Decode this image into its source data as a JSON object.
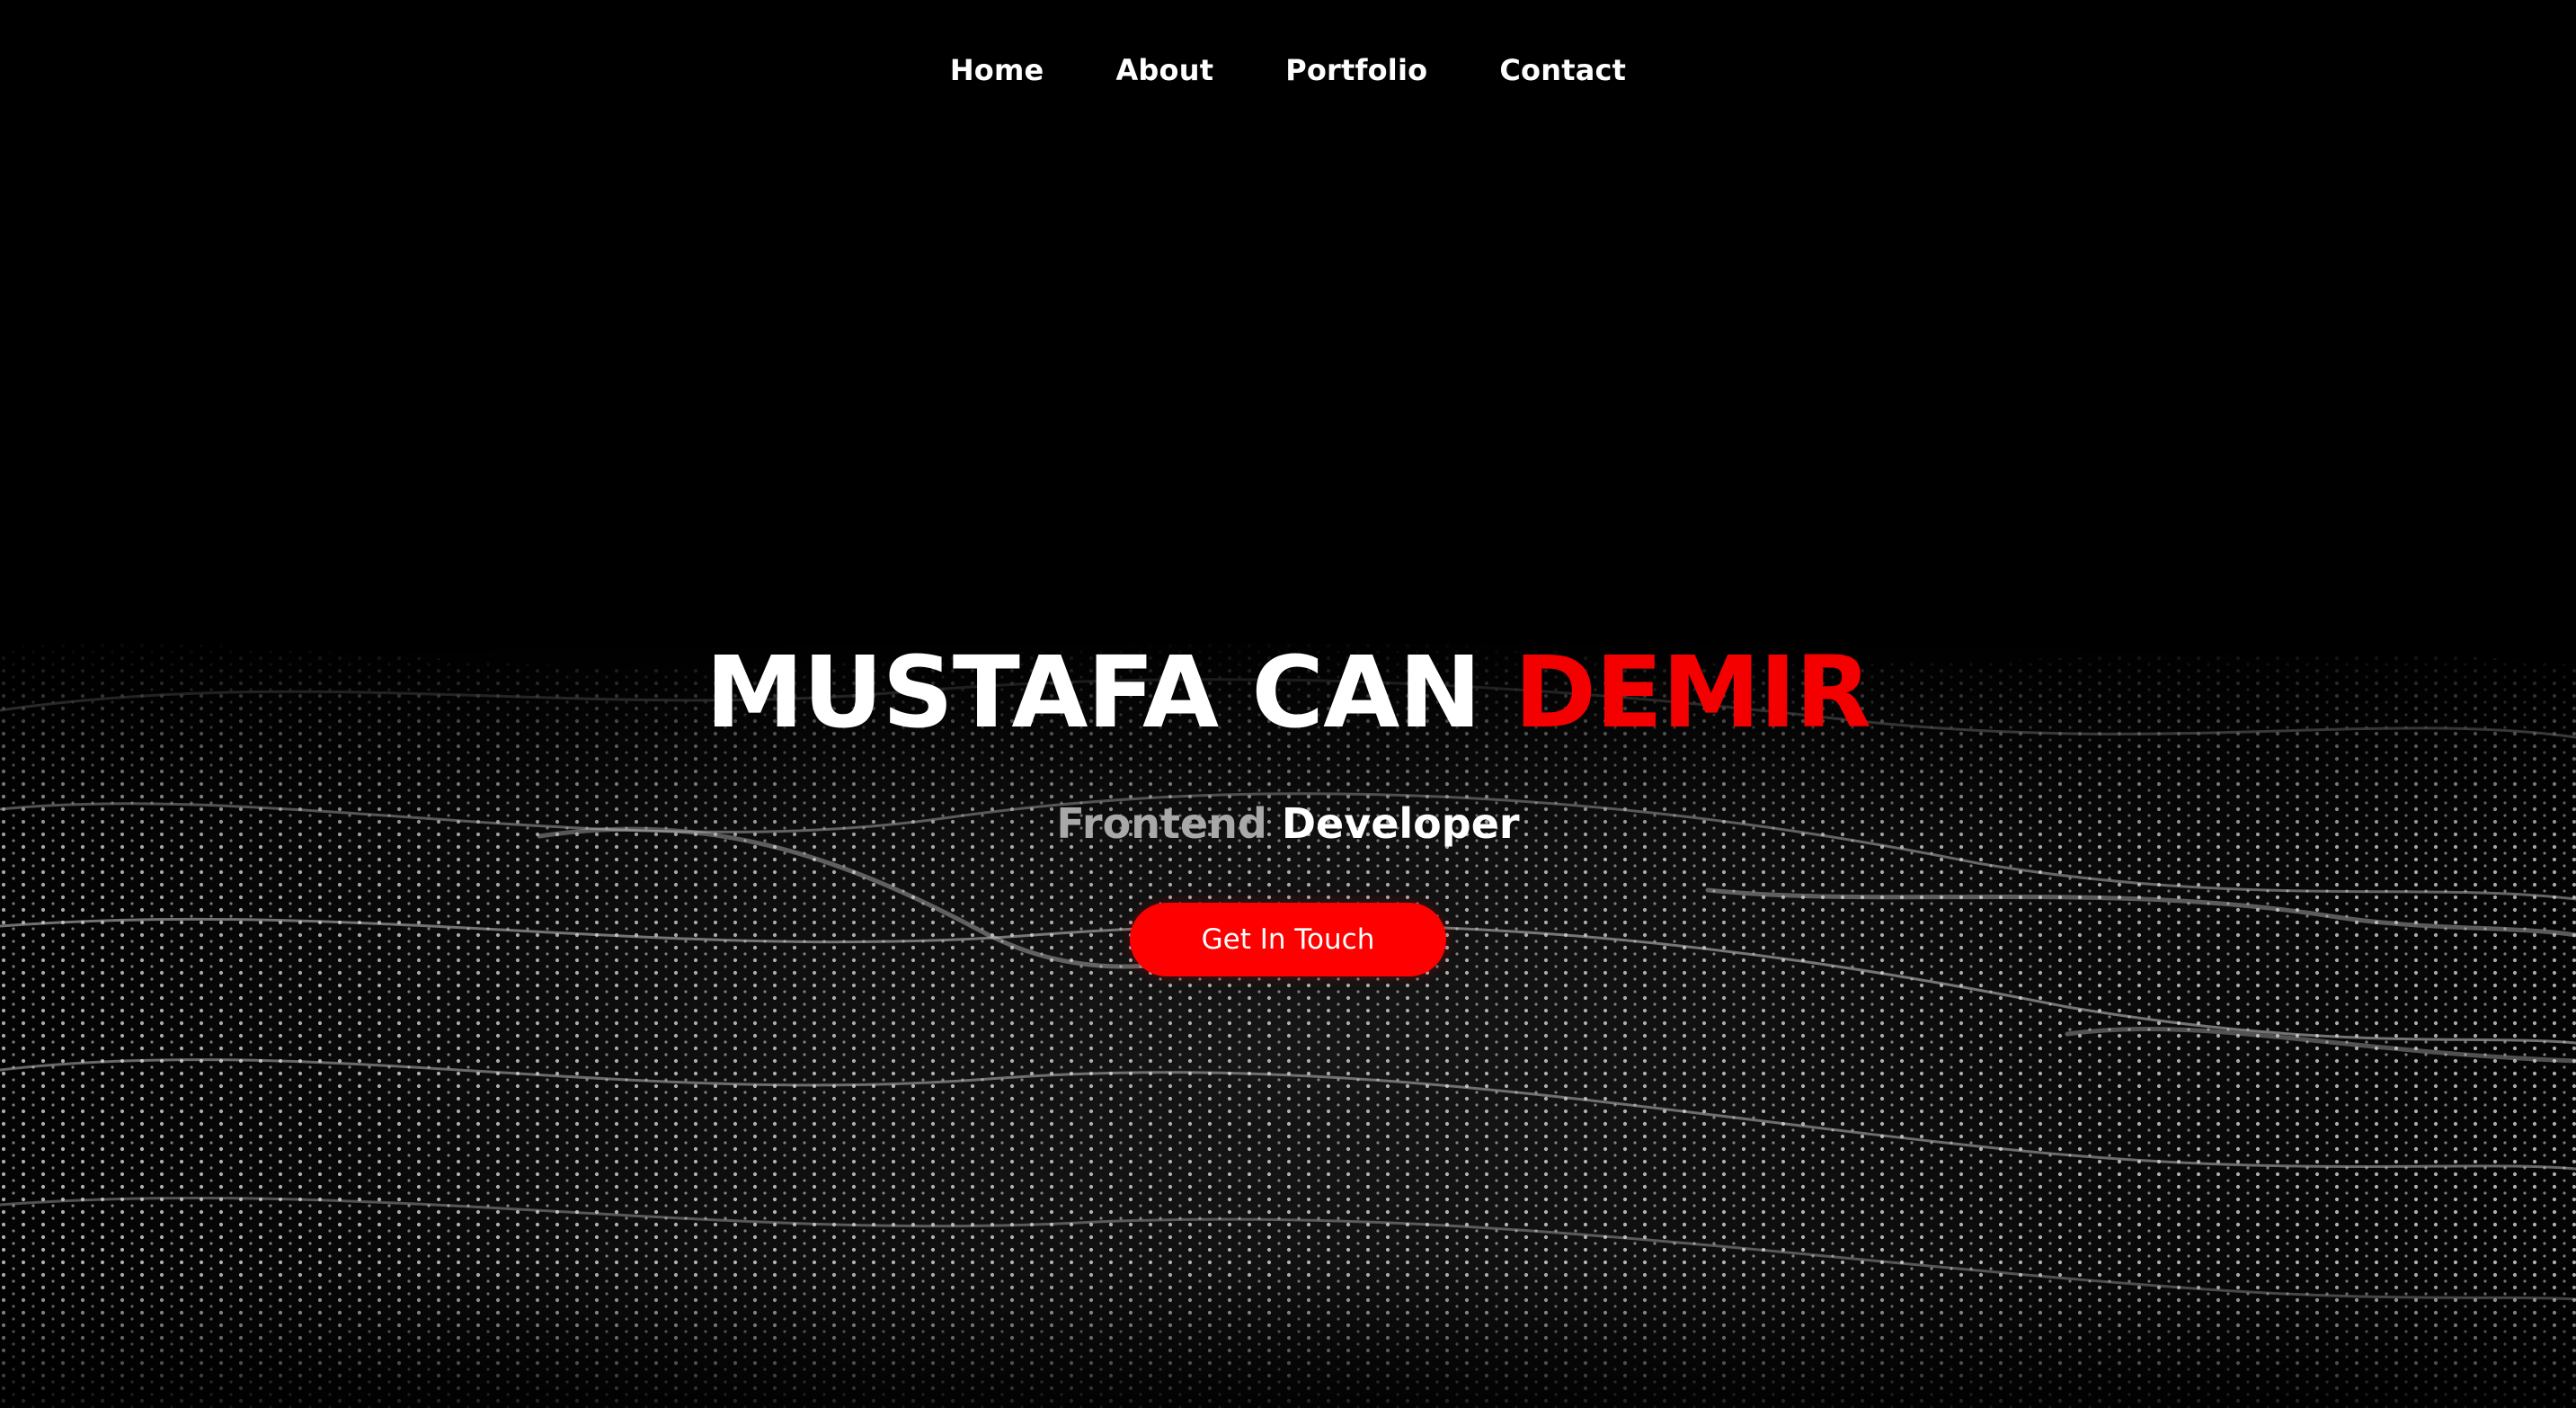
{
  "nav": {
    "items": [
      {
        "label": "Home"
      },
      {
        "label": "About"
      },
      {
        "label": "Portfolio"
      },
      {
        "label": "Contact"
      }
    ]
  },
  "hero": {
    "name_first": "MUSTAFA CAN",
    "name_last": "DEMIR",
    "role_muted": "Frontend",
    "role_strong": "Developer",
    "cta_label": "Get In Touch"
  },
  "colors": {
    "background": "#000000",
    "accent": "#ff0000",
    "muted_text": "#a8a8a8",
    "text": "#ffffff"
  },
  "background_visual": "particle-wave-mesh"
}
